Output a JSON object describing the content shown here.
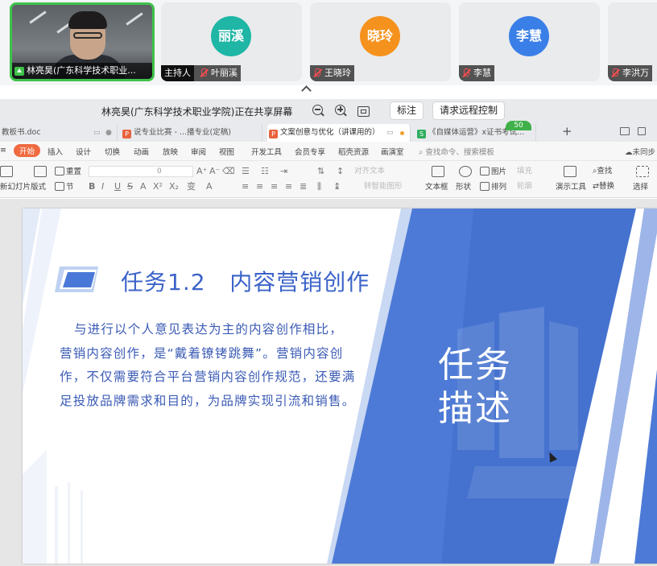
{
  "meeting": {
    "participants": [
      {
        "name": "林亮昊(广东科学技术职业...",
        "role": "",
        "has_video": true
      },
      {
        "name": "叶丽溪",
        "avatar_text": "丽溪",
        "avatar_color": "#1fb6a6",
        "host_label": "主持人",
        "muted": true
      },
      {
        "name": "王晓玲",
        "avatar_text": "晓玲",
        "avatar_color": "#f5921e",
        "muted": true
      },
      {
        "name": "李慧",
        "avatar_text": "李慧",
        "avatar_color": "#3a7fe8",
        "muted": true
      },
      {
        "name": "李洪万",
        "muted": true
      }
    ],
    "sharing_text": "林亮昊(广东科学技术职业学院)正在共享屏幕",
    "annotate_label": "标注",
    "remote_control_label": "请求远程控制"
  },
  "wps": {
    "tabs": [
      {
        "label": "教板书.doc",
        "icon_color": "#3b78e7"
      },
      {
        "label": "说专业比赛 - ...播专业(定稿)",
        "icon": "P",
        "icon_color": "#e8623d"
      },
      {
        "label": "文案创意与优化（讲课用的）",
        "icon": "P",
        "icon_color": "#e8623d",
        "active": true,
        "unsaved_dot_color": "#f0a030"
      },
      {
        "label": "《自媒体运营》x证书考试...",
        "icon": "S",
        "icon_color": "#2fae5e"
      }
    ],
    "badge_count": "50",
    "menu": [
      "开始",
      "插入",
      "设计",
      "切换",
      "动画",
      "放映",
      "审阅",
      "视图",
      "开发工具",
      "会员专享",
      "稻壳资源",
      "画演室"
    ],
    "search_placeholder": "查找命令、搜索模板",
    "sync_label": "未同步",
    "toolbar": {
      "new_slide": "新幻灯片",
      "layout": "版式",
      "reset": "重置",
      "section": "节",
      "font_size": "0",
      "align_text": "对齐文本",
      "smartart": "转智能图形",
      "textbox": "文本框",
      "shape": "形状",
      "picture": "图片",
      "arrange": "排列",
      "fill": "填充",
      "outline": "轮廓",
      "present_tools": "演示工具",
      "find": "查找",
      "replace": "替换",
      "select": "选择"
    }
  },
  "slide": {
    "title": "任务1.2   内容营销创作",
    "body": "与进行以个人意见表达为主的内容创作相比，营销内容创作，是“戴着镣铐跳舞”。营销内容创作，不仅需要符合平台营销内容创作规范，还要满足投放品牌需求和目的，为品牌实现引流和销售。",
    "side_label": "任务描述",
    "colors": {
      "accent": "#4a78d8",
      "text": "#3b5bb5",
      "light_panel": "#dfe8f8"
    }
  }
}
